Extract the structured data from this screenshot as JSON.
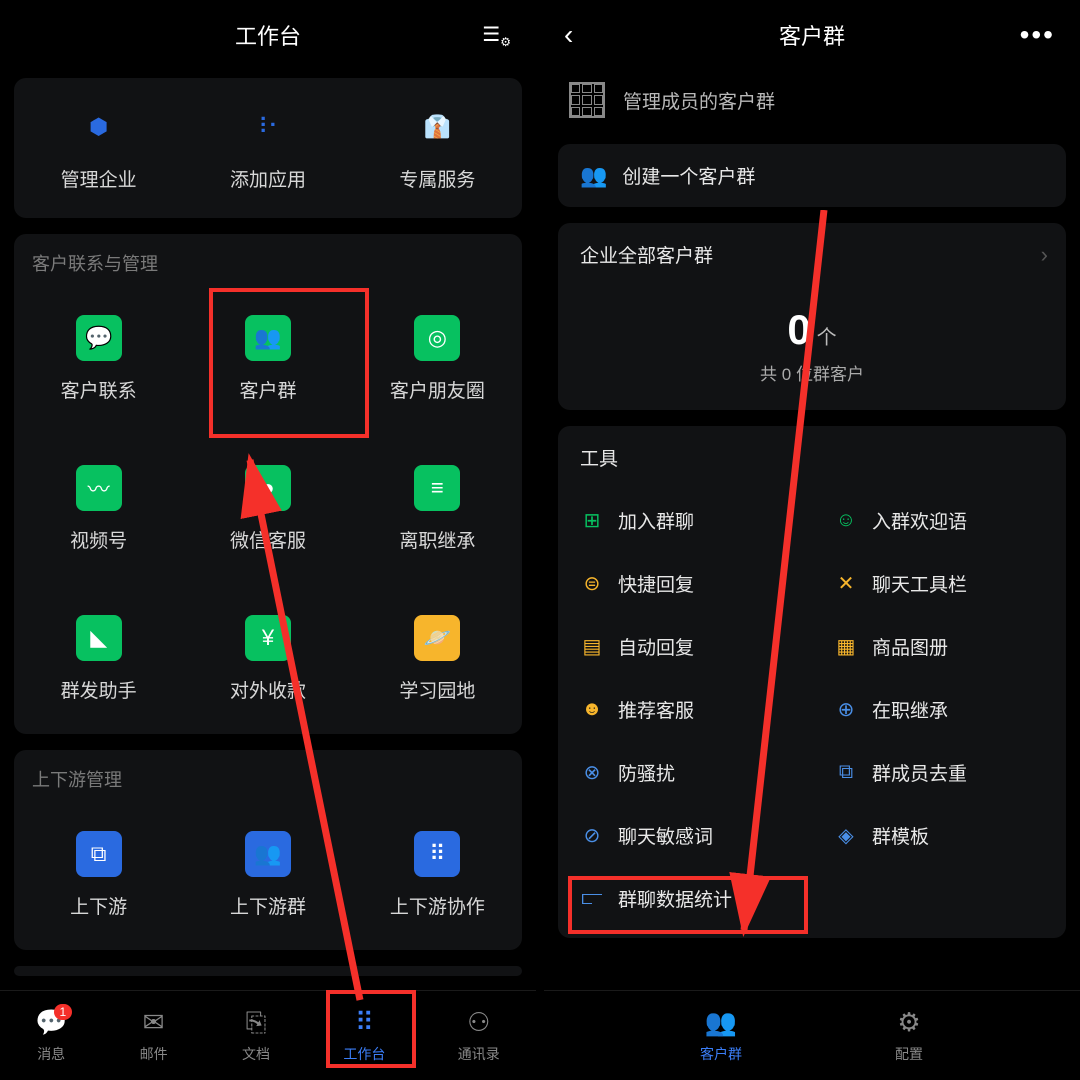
{
  "left": {
    "title": "工作台",
    "topGrid": [
      {
        "label": "管理企业",
        "icon": "⬢",
        "bg": "transparent",
        "fg": "#2a6ae0"
      },
      {
        "label": "添加应用",
        "icon": "⠸⠂",
        "bg": "transparent",
        "fg": "#2a6ae0"
      },
      {
        "label": "专属服务",
        "icon": "👔",
        "bg": "transparent",
        "fg": "#2a6ae0"
      }
    ],
    "section1": {
      "title": "客户联系与管理",
      "items": [
        {
          "label": "客户联系",
          "icon": "💬",
          "bg": "#07c160"
        },
        {
          "label": "客户群",
          "icon": "👥",
          "bg": "#07c160"
        },
        {
          "label": "客户朋友圈",
          "icon": "◎",
          "bg": "#07c160"
        },
        {
          "label": "视频号",
          "icon": "〰",
          "bg": "#07c160"
        },
        {
          "label": "微信客服",
          "icon": "●",
          "bg": "#07c160"
        },
        {
          "label": "离职继承",
          "icon": "≡",
          "bg": "#07c160"
        },
        {
          "label": "群发助手",
          "icon": "◣",
          "bg": "#07c160"
        },
        {
          "label": "对外收款",
          "icon": "¥",
          "bg": "#07c160"
        },
        {
          "label": "学习园地",
          "icon": "🪐",
          "bg": "#f7b52c"
        }
      ]
    },
    "section2": {
      "title": "上下游管理",
      "items": [
        {
          "label": "上下游",
          "icon": "⧉",
          "bg": "#2a6ae0"
        },
        {
          "label": "上下游群",
          "icon": "👥",
          "bg": "#2a6ae0"
        },
        {
          "label": "上下游协作",
          "icon": "⠿",
          "bg": "#2a6ae0"
        }
      ]
    },
    "nav": [
      {
        "label": "消息",
        "icon": "💬",
        "badge": "1"
      },
      {
        "label": "邮件",
        "icon": "✉"
      },
      {
        "label": "文档",
        "icon": "⎘"
      },
      {
        "label": "工作台",
        "icon": "⠿",
        "active": true
      },
      {
        "label": "通讯录",
        "icon": "⚇"
      }
    ]
  },
  "right": {
    "title": "客户群",
    "manageRow": "管理成员的客户群",
    "createRow": "创建一个客户群",
    "allGroups": "企业全部客户群",
    "stat": {
      "count": "0",
      "unit": "个",
      "sub": "共 0 位群客户"
    },
    "toolsTitle": "工具",
    "tools": [
      {
        "label": "加入群聊",
        "icon": "⊞",
        "c": "#07c160"
      },
      {
        "label": "入群欢迎语",
        "icon": "☺",
        "c": "#07c160"
      },
      {
        "label": "快捷回复",
        "icon": "⊜",
        "c": "#f7b52c"
      },
      {
        "label": "聊天工具栏",
        "icon": "✕",
        "c": "#f7b52c"
      },
      {
        "label": "自动回复",
        "icon": "▤",
        "c": "#f7b52c"
      },
      {
        "label": "商品图册",
        "icon": "▦",
        "c": "#f7b52c"
      },
      {
        "label": "推荐客服",
        "icon": "☻",
        "c": "#f7b52c"
      },
      {
        "label": "在职继承",
        "icon": "⊕",
        "c": "#4a8fe7"
      },
      {
        "label": "防骚扰",
        "icon": "⊗",
        "c": "#4a8fe7"
      },
      {
        "label": "群成员去重",
        "icon": "⧉",
        "c": "#4a8fe7"
      },
      {
        "label": "聊天敏感词",
        "icon": "⊘",
        "c": "#4a8fe7"
      },
      {
        "label": "群模板",
        "icon": "◈",
        "c": "#4a8fe7"
      },
      {
        "label": "群聊数据统计",
        "icon": "⫍",
        "c": "#4a8fe7"
      }
    ],
    "nav": [
      {
        "label": "客户群",
        "icon": "👥",
        "active": true
      },
      {
        "label": "配置",
        "icon": "⚙"
      }
    ]
  }
}
